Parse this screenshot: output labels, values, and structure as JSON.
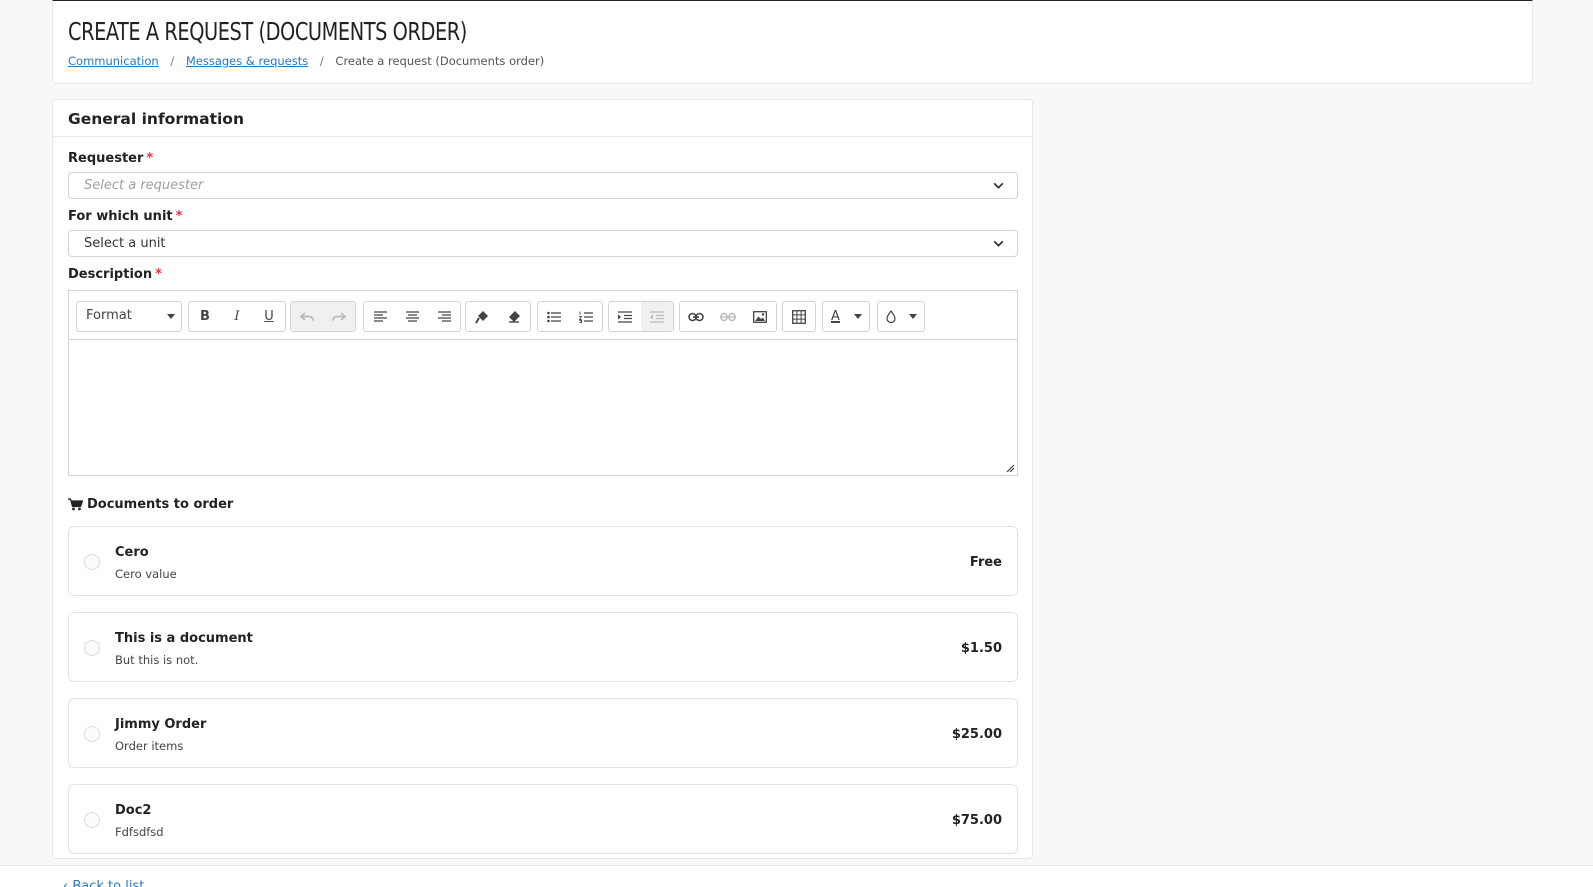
{
  "header": {
    "title": "CREATE A REQUEST (DOCUMENTS ORDER)",
    "breadcrumb": [
      {
        "label": "Communication"
      },
      {
        "label": "Messages & requests"
      },
      {
        "label": "Create a request (Documents order)"
      }
    ],
    "separator": "/"
  },
  "card": {
    "title": "General information",
    "required_mark": "*",
    "requester": {
      "label": "Requester",
      "placeholder": "Select a requester"
    },
    "unit": {
      "label": "For which unit",
      "value": "Select a unit"
    },
    "description": {
      "label": "Description",
      "format_label": "Format",
      "toolbar_icons": [
        "bold-icon",
        "italic-icon",
        "underline-icon",
        "undo-icon",
        "redo-icon",
        "align-left-icon",
        "align-center-icon",
        "align-right-icon",
        "format-painter-icon",
        "clear-format-icon",
        "bullet-list-icon",
        "numbered-list-icon",
        "indent-icon",
        "outdent-icon",
        "link-icon",
        "unlink-icon",
        "image-icon",
        "table-icon",
        "text-color-icon",
        "background-color-icon"
      ],
      "bold": "B",
      "italic": "I",
      "underline": "U",
      "text_color": "A"
    },
    "documents": {
      "title": "Documents to order",
      "icon": "cart-icon",
      "items": [
        {
          "name": "Cero",
          "description": "Cero value",
          "price": "Free"
        },
        {
          "name": "This is a document",
          "description": "But this is not.",
          "price": "$1.50"
        },
        {
          "name": "Jimmy Order",
          "description": "Order items",
          "price": "$25.00"
        },
        {
          "name": "Doc2",
          "description": "Fdfsdfsd",
          "price": "$75.00"
        }
      ]
    }
  },
  "footer": {
    "back_label": "Back to list"
  },
  "colors": {
    "link": "#2a7ab8",
    "required": "#dc3545",
    "border": "#e6e8ec"
  }
}
